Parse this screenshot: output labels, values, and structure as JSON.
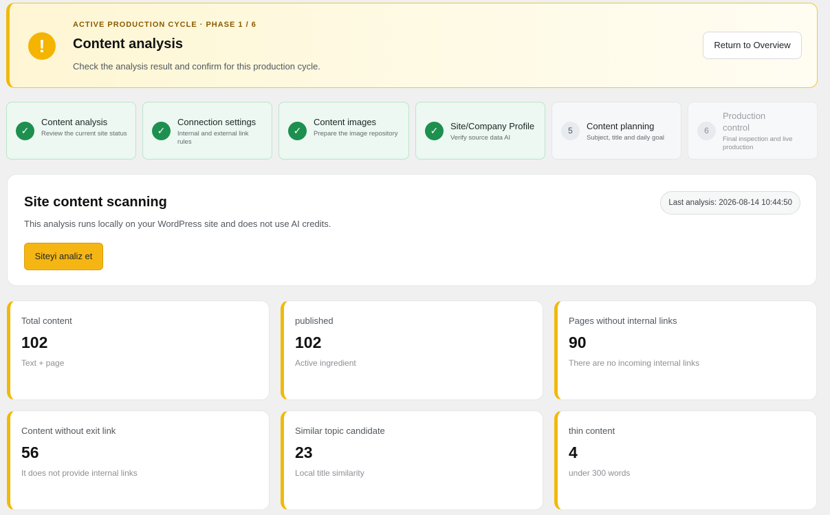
{
  "banner": {
    "eyebrow": "ACTIVE PRODUCTION CYCLE · PHASE 1 / 6",
    "title": "Content analysis",
    "description": "Check the analysis result and confirm for this production cycle.",
    "overview_button": "Return to Overview",
    "icon": "warning-icon"
  },
  "steps": [
    {
      "number": "✓",
      "title": "Content analysis",
      "subtitle": "Review the current site status",
      "state": "done"
    },
    {
      "number": "✓",
      "title": "Connection settings",
      "subtitle": "Internal and external link rules",
      "state": "done"
    },
    {
      "number": "✓",
      "title": "Content images",
      "subtitle": "Prepare the image repository",
      "state": "done"
    },
    {
      "number": "✓",
      "title": "Site/Company Profile",
      "subtitle": "Verify source data AI",
      "state": "done"
    },
    {
      "number": "5",
      "title": "Content planning",
      "subtitle": "Subject, title and daily goal",
      "state": "pending"
    },
    {
      "number": "6",
      "title": "Production control",
      "subtitle": "Final inspection and live production",
      "state": "disabled"
    }
  ],
  "scan": {
    "title": "Site content scanning",
    "description": "This analysis runs locally on your WordPress site and does not use AI credits.",
    "last_analysis": "Last analysis: 2026-08-14 10:44:50",
    "button": "Siteyi analiz et"
  },
  "stats": [
    {
      "label": "Total content",
      "value": "102",
      "sub": "Text + page"
    },
    {
      "label": "published",
      "value": "102",
      "sub": "Active ingredient"
    },
    {
      "label": "Pages without internal links",
      "value": "90",
      "sub": "There are no incoming internal links"
    },
    {
      "label": "Content without exit link",
      "value": "56",
      "sub": "It does not provide internal links"
    },
    {
      "label": "Similar topic candidate",
      "value": "23",
      "sub": "Local title similarity"
    },
    {
      "label": "thin content",
      "value": "4",
      "sub": "under 300 words"
    }
  ],
  "colors": {
    "accent": "#f0b90b",
    "success": "#1d8f4f",
    "button": "#f5b614"
  }
}
